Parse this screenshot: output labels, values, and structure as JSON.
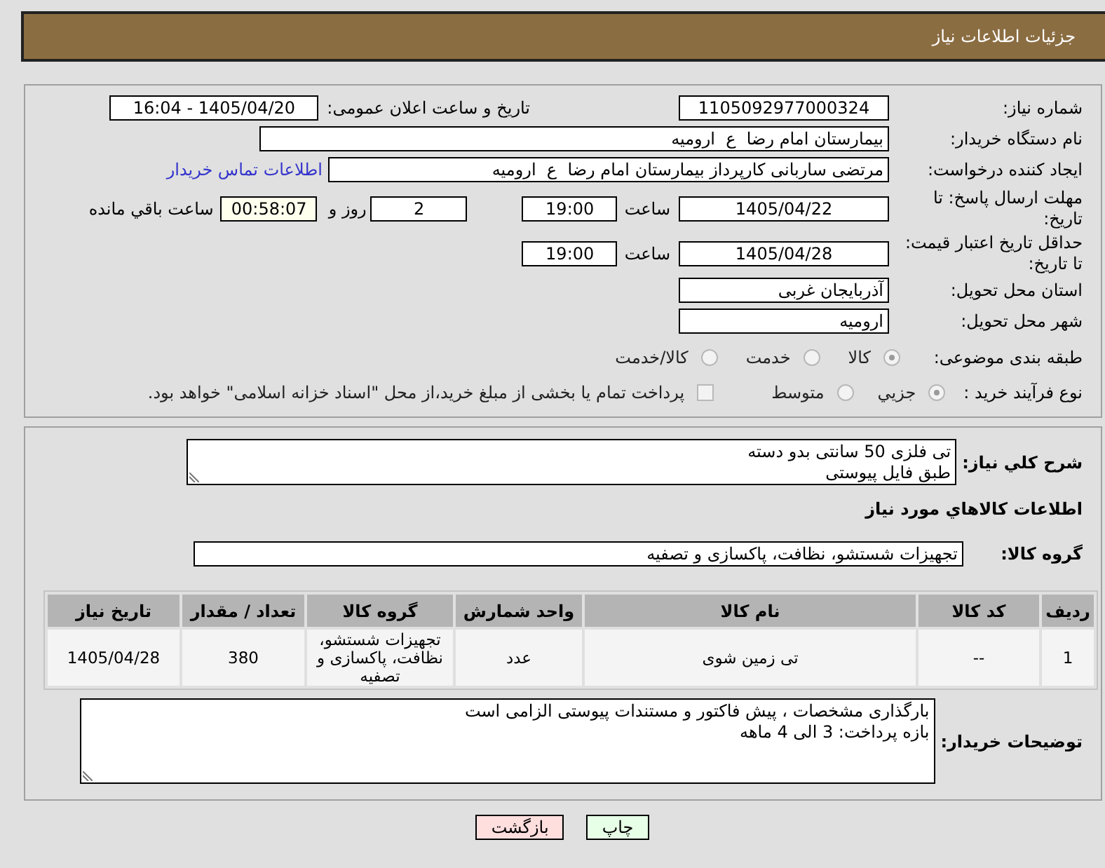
{
  "header": {
    "title": "جزئیات اطلاعات نیاز"
  },
  "details": {
    "need_number": {
      "label": "شماره نیاز:",
      "value": "1105092977000324"
    },
    "announcement": {
      "label": "تاریخ و ساعت اعلان عمومی:",
      "value": "1405/04/20 - 16:04"
    },
    "buyer_org": {
      "label": "نام دستگاه خریدار:",
      "value": "بیمارستان امام رضا  ع  ارومیه"
    },
    "requester": {
      "label": "ایجاد کننده درخواست:",
      "value": "مرتضی ساربانی کارپرداز بیمارستان امام رضا  ع  ارومیه",
      "contact_link": "اطلاعات تماس خریدار"
    },
    "reply_deadline": {
      "label": "مهلت ارسال پاسخ: تا تاریخ:",
      "date": "1405/04/22",
      "time_label": "ساعت",
      "time": "19:00",
      "days": "2",
      "days_label": "روز و",
      "remaining": "00:58:07",
      "remaining_label": "ساعت باقي مانده"
    },
    "price_validity": {
      "label": "حداقل تاریخ اعتبار قیمت: تا تاریخ:",
      "date": "1405/04/28",
      "time_label": "ساعت",
      "time": "19:00"
    },
    "delivery_province": {
      "label": "استان محل تحویل:",
      "value": "آذربایجان غربی"
    },
    "delivery_city": {
      "label": "شهر محل تحویل:",
      "value": "ارومیه"
    },
    "category": {
      "label": "طبقه بندی موضوعی:",
      "options": [
        {
          "label": "کالا",
          "selected": true
        },
        {
          "label": "خدمت",
          "selected": false
        },
        {
          "label": "کالا/خدمت",
          "selected": false
        }
      ]
    },
    "purchase_process": {
      "label": "نوع فرآیند خرید :",
      "options": [
        {
          "label": "جزیي",
          "selected": true
        },
        {
          "label": "متوسط",
          "selected": false
        }
      ],
      "treasury_payment": {
        "label": "پرداخت تمام یا بخشی از مبلغ خرید،از محل \"اسناد خزانه اسلامی\" خواهد بود.",
        "checked": false
      }
    }
  },
  "need": {
    "description": {
      "label": "شرح کلي نیاز:",
      "value": "تی فلزی 50 سانتی بدو دسته\nطبق فایل پیوستی"
    },
    "goods_heading": "اطلاعات کالاهاي مورد نیاز",
    "goods_group": {
      "label": "گروه کالا:",
      "value": "تجهیزات شستشو، نظافت، پاکسازی و تصفیه"
    },
    "table": {
      "columns": [
        "ردیف",
        "کد کالا",
        "نام کالا",
        "واحد شمارش",
        "گروه کالا",
        "تعداد / مقدار",
        "تاریخ نیاز"
      ],
      "rows": [
        [
          "1",
          "--",
          "تی زمین شوی",
          "عدد",
          "تجهیزات شستشو، نظافت، پاکسازی و تصفیه",
          "380",
          "1405/04/28"
        ]
      ]
    },
    "buyer_notes": {
      "label": "توضیحات خریدار:",
      "value": "بارگذاری مشخصات ، پیش فاکتور و مستندات پیوستی الزامی است\nبازه پرداخت: 3 الی 4 ماهه"
    }
  },
  "buttons": [
    {
      "label": "چاپ",
      "kind": "print"
    },
    {
      "label": "بازگشت",
      "kind": "back"
    }
  ]
}
